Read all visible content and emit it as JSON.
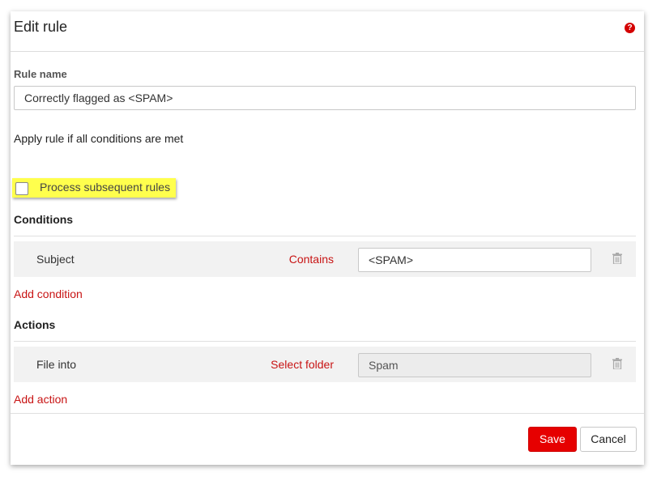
{
  "dialog": {
    "title": "Edit rule",
    "help_icon_glyph": "?",
    "help_icon": "question-circle-icon"
  },
  "rule_name": {
    "label": "Rule name",
    "value": "Correctly flagged as <SPAM>"
  },
  "apply_text": "Apply rule if all conditions are met",
  "process_subsequent": {
    "label": "Process subsequent rules",
    "checked": false,
    "highlight_color": "#ffff4d"
  },
  "conditions": {
    "title": "Conditions",
    "rows": [
      {
        "field": "Subject",
        "operator": "Contains",
        "value": "<SPAM>"
      }
    ],
    "add_label": "Add condition"
  },
  "actions": {
    "title": "Actions",
    "rows": [
      {
        "action": "File into",
        "link": "Select folder",
        "value": "Spam"
      }
    ],
    "add_label": "Add action"
  },
  "buttons": {
    "save": "Save",
    "cancel": "Cancel"
  },
  "colors": {
    "accent": "#c81414",
    "primary_button": "#e60000"
  }
}
